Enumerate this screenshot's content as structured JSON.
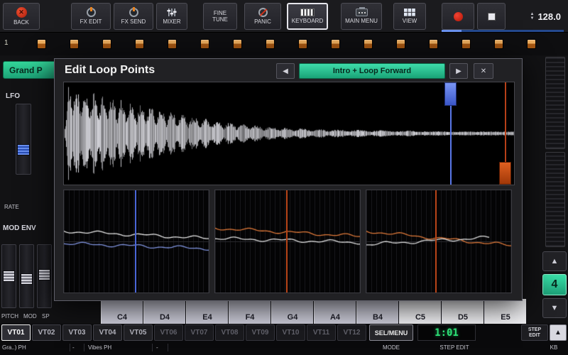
{
  "colors": {
    "accent_green": "#2bc792",
    "marker_blue": "#5570e0",
    "marker_orange": "#c84a12",
    "lcd_green": "#2ee87a",
    "record_red": "#e02818",
    "progress_blue": "#4a78e0"
  },
  "toolbar": {
    "back": "BACK",
    "fx_edit": "FX EDIT",
    "fx_send": "FX SEND",
    "mixer": "MIXER",
    "fine_tune": "FINE TUNE",
    "panic": "PANIC",
    "keyboard": "KEYBOARD",
    "main_menu": "MAIN MENU",
    "view": "VIEW",
    "tempo": "128.0"
  },
  "pad_row": {
    "pattern_number": "1"
  },
  "dialog": {
    "title": "Edit Loop Points",
    "loop_mode": "Intro + Loop Forward"
  },
  "icons": {
    "prev": "◀",
    "next": "▶",
    "close": "✕",
    "up": "▲",
    "down": "▼"
  },
  "left_panel": {
    "preset": "Grand P",
    "lfo": "LFO",
    "rate": "RATE",
    "mod_env": "MOD ENV",
    "pitch": "PITCH",
    "mod": "MOD",
    "sp": "SP"
  },
  "right_panel": {
    "octave": "4"
  },
  "keys": {
    "labels": [
      "C4",
      "D4",
      "E4",
      "F4",
      "G4",
      "A4",
      "B4",
      "C5",
      "D5",
      "E5"
    ]
  },
  "tracks": {
    "labels": [
      "VT01",
      "VT02",
      "VT03",
      "VT04",
      "VT05",
      "VT06",
      "VT07",
      "VT08",
      "VT09",
      "VT10",
      "VT11",
      "VT12"
    ],
    "sel_menu": "SEL/MENU",
    "position": "1:01",
    "step": "STEP",
    "edit": "EDIT"
  },
  "status": {
    "name1": "Gra..) PH",
    "name2": "-",
    "name3": "Vibes PH",
    "name4": "-",
    "mode": "MODE",
    "step_edit": "STEP EDIT",
    "kb": "KB"
  }
}
